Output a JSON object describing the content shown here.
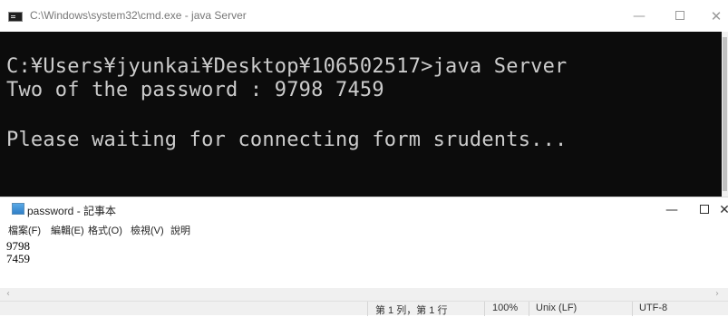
{
  "cmd": {
    "title": "C:\\Windows\\system32\\cmd.exe - java  Server",
    "lines": [
      "C:¥Users¥jyunkai¥Desktop¥106502517>java Server",
      "Two of the password : 9798 7459",
      "Please waiting for connecting form srudents..."
    ],
    "controls": {
      "minimize": "—",
      "close": "✕"
    }
  },
  "notepad": {
    "title": "password - 記事本",
    "menu": [
      "檔案(F)",
      "編輯(E)",
      "格式(O)",
      "檢視(V)",
      "說明"
    ],
    "content": [
      "9798",
      "7459"
    ],
    "controls": {
      "minimize": "—",
      "close": "✕"
    },
    "status": {
      "position": "第 1 列，第 1 行",
      "zoom": "100%",
      "line_ending": "Unix (LF)",
      "encoding": "UTF-8"
    },
    "scroll": {
      "left": "‹",
      "right": "›"
    }
  }
}
